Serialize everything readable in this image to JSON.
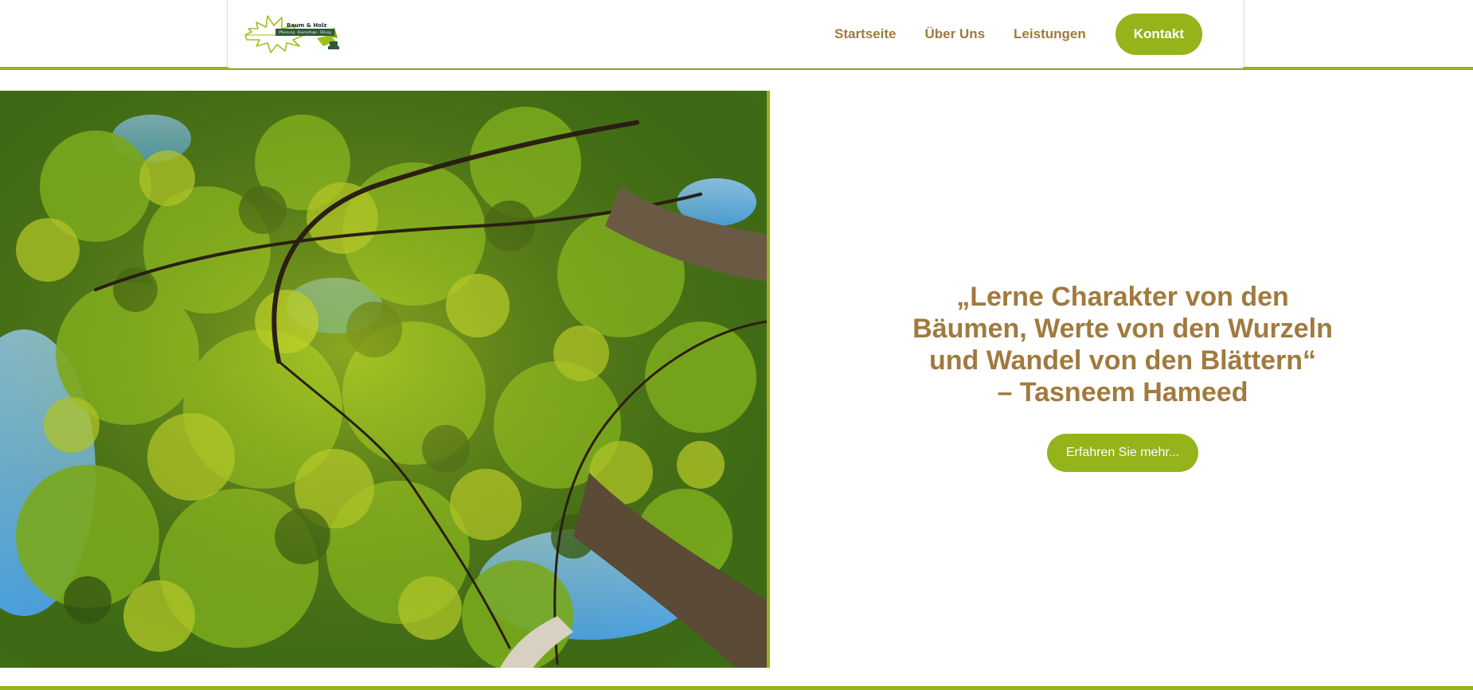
{
  "brand": {
    "name": "Baum & Holz",
    "tagline": "Pflanzung · Baumpflege · Fällung",
    "colors": {
      "accent": "#95b31a",
      "text": "#a07a3e",
      "dark": "#2f5a3a"
    }
  },
  "nav": {
    "items": [
      {
        "label": "Startseite"
      },
      {
        "label": "Über Uns"
      },
      {
        "label": "Leistungen"
      }
    ],
    "cta": "Kontakt"
  },
  "hero": {
    "image_icon": "tree-canopy-photo",
    "quote_lines": [
      "„Lerne Charakter von den",
      "Bäumen, Werte von den Wurzeln",
      "und Wandel von den Blättern“",
      "– Tasneem Hameed"
    ],
    "button": "Erfahren Sie mehr..."
  }
}
